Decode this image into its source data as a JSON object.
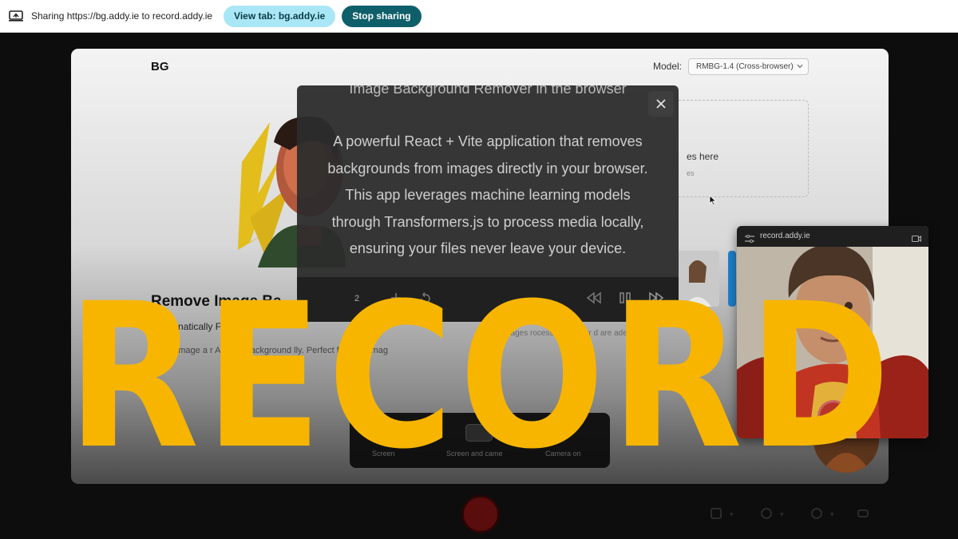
{
  "sharebar": {
    "text": "Sharing https://bg.addy.ie to record.addy.ie",
    "view_tab_label": "View tab: bg.addy.ie",
    "stop_label": "Stop sharing"
  },
  "app": {
    "brand": "BG",
    "model_label": "Model:",
    "model_value": "RMBG-1.4 (Cross-browser)",
    "dropzone_primary": "es here",
    "dropzone_secondary": "es",
    "headline": "Remove Image Ba",
    "subhead": "100%    natically    Free",
    "description": "Uploa    image a    r AI r    the background    lly. Perfect f    profe    t imag",
    "privacy_note": "images    rocessed    on your    d are    ade"
  },
  "modal": {
    "title": "Image Background Remover in the browser",
    "body_lines": [
      "A powerful React + Vite application that removes",
      "backgrounds from images directly in your browser.",
      "This app leverages machine learning models",
      "through Transformers.js to process media locally,",
      "ensuring your files never leave your device."
    ],
    "speed": "2"
  },
  "recorder": {
    "options": [
      "Screen",
      "Screen and came",
      "Camera on"
    ]
  },
  "camera": {
    "title": "record.addy.ie"
  },
  "overlay_word": "RECORD",
  "colors": {
    "accent_yellow": "#f7b500",
    "view_tab_bg": "#a9e7f6",
    "stop_bg": "#0f5f6a",
    "record_red": "#b7342b"
  }
}
